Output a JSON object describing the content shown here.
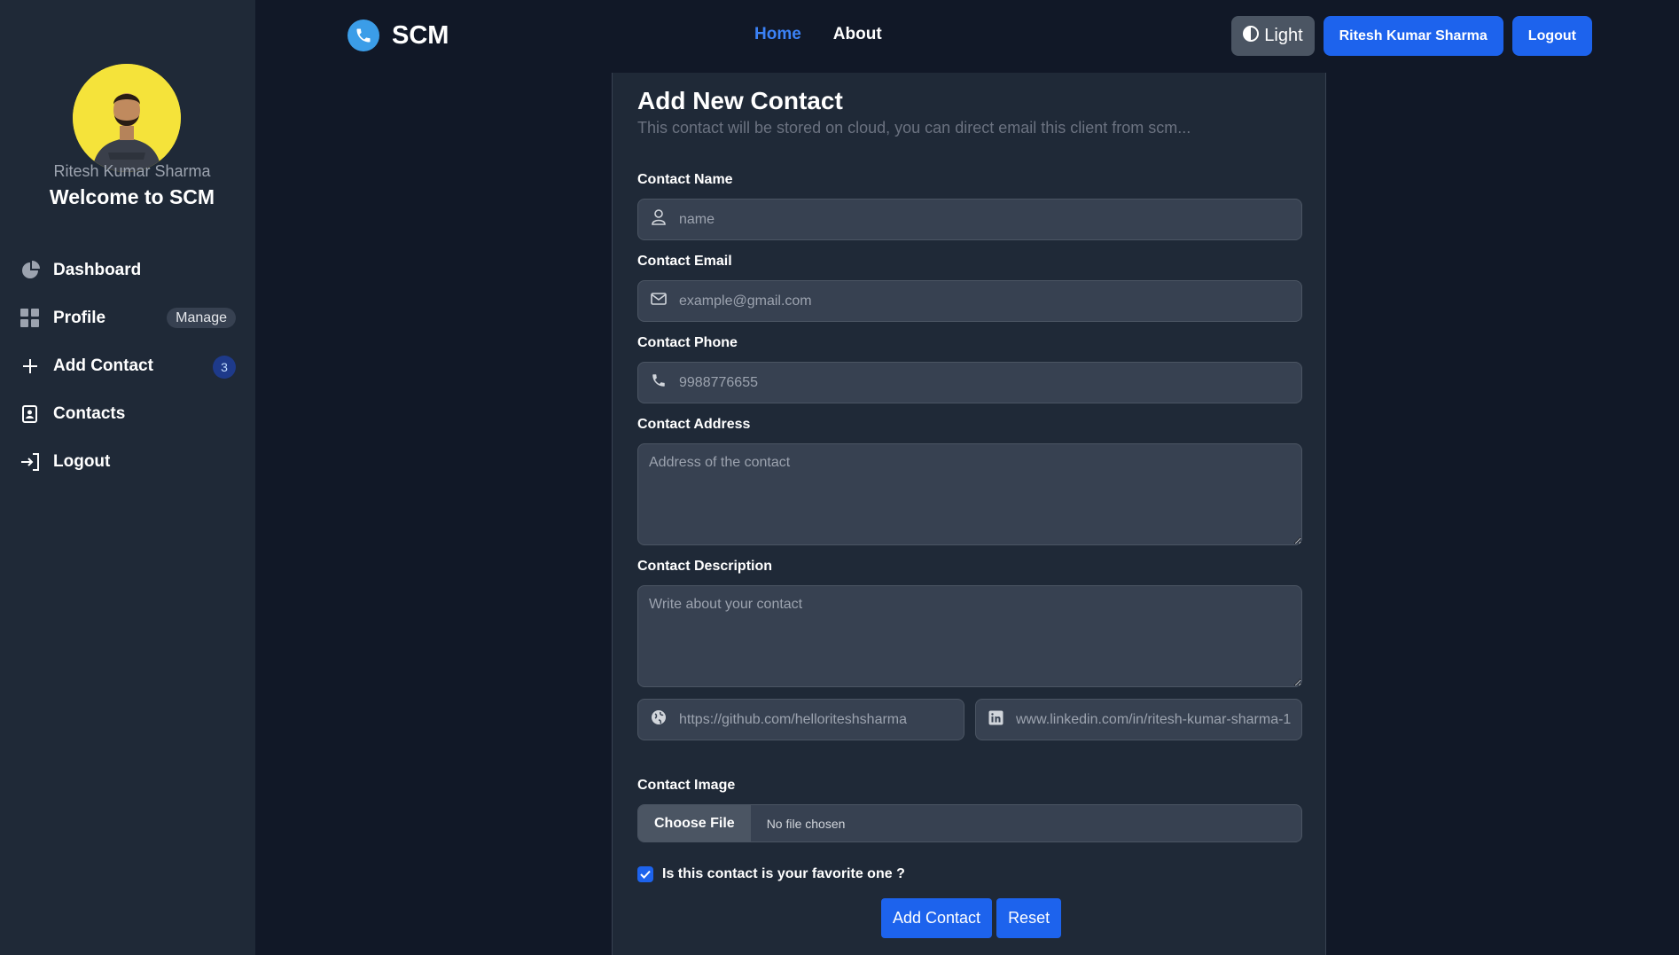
{
  "navbar": {
    "brand": "SCM",
    "links": {
      "home": "Home",
      "about": "About"
    },
    "theme_label": "Light",
    "user_button": "Ritesh Kumar Sharma",
    "logout_button": "Logout"
  },
  "sidebar": {
    "username": "Ritesh Kumar Sharma",
    "welcome": "Welcome to SCM",
    "items": [
      {
        "label": "Dashboard",
        "icon": "chart-pie-icon"
      },
      {
        "label": "Profile",
        "icon": "grid-icon",
        "badge": "Manage"
      },
      {
        "label": "Add Contact",
        "icon": "plus-icon",
        "badge": "3"
      },
      {
        "label": "Contacts",
        "icon": "address-book-icon"
      },
      {
        "label": "Logout",
        "icon": "sign-in-icon"
      }
    ]
  },
  "form": {
    "title": "Add New Contact",
    "subtitle": "This contact will be stored on cloud, you can direct email this client from scm...",
    "name": {
      "label": "Contact Name",
      "placeholder": "name"
    },
    "email": {
      "label": "Contact Email",
      "placeholder": "example@gmail.com"
    },
    "phone": {
      "label": "Contact Phone",
      "placeholder": "9988776655"
    },
    "address": {
      "label": "Contact Address",
      "placeholder": "Address of the contact"
    },
    "description": {
      "label": "Contact Description",
      "placeholder": "Write about your contact"
    },
    "website": {
      "placeholder": "https://github.com/helloriteshsharma"
    },
    "linkedin": {
      "placeholder": "www.linkedin.com/in/ritesh-kumar-sharma-1"
    },
    "image": {
      "label": "Contact Image",
      "button": "Choose File",
      "status": "No file chosen"
    },
    "favorite": {
      "label": "Is this contact is your favorite one ?",
      "checked": true
    },
    "submit": "Add Contact",
    "reset": "Reset"
  }
}
